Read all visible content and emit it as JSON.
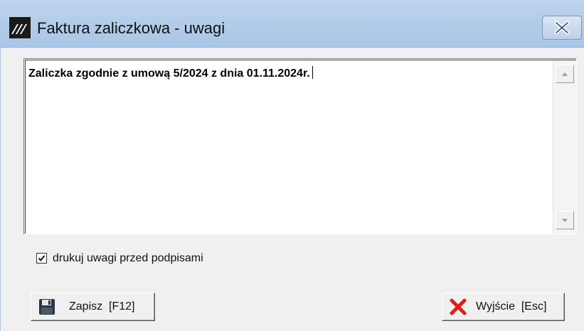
{
  "window": {
    "title": "Faktura zaliczkowa - uwagi",
    "app_icon": "app-logo-icon",
    "close_icon": "close-icon"
  },
  "memo": {
    "text": "Zaliczka zgodnie z umową 5/2024 z dnia 01.11.2024r."
  },
  "options": {
    "print_notes_label": "drukuj uwagi przed podpisami",
    "print_notes_checked": true
  },
  "buttons": {
    "save_label": "Zapisz  [F12]",
    "save_icon": "floppy-disk-icon",
    "exit_label": "Wyjście  [Esc]",
    "exit_icon": "red-x-icon"
  },
  "colors": {
    "titlebar": "#b1cbe8",
    "window_bg": "#f0f0f0",
    "exit_icon_red": "#e21b1b"
  }
}
